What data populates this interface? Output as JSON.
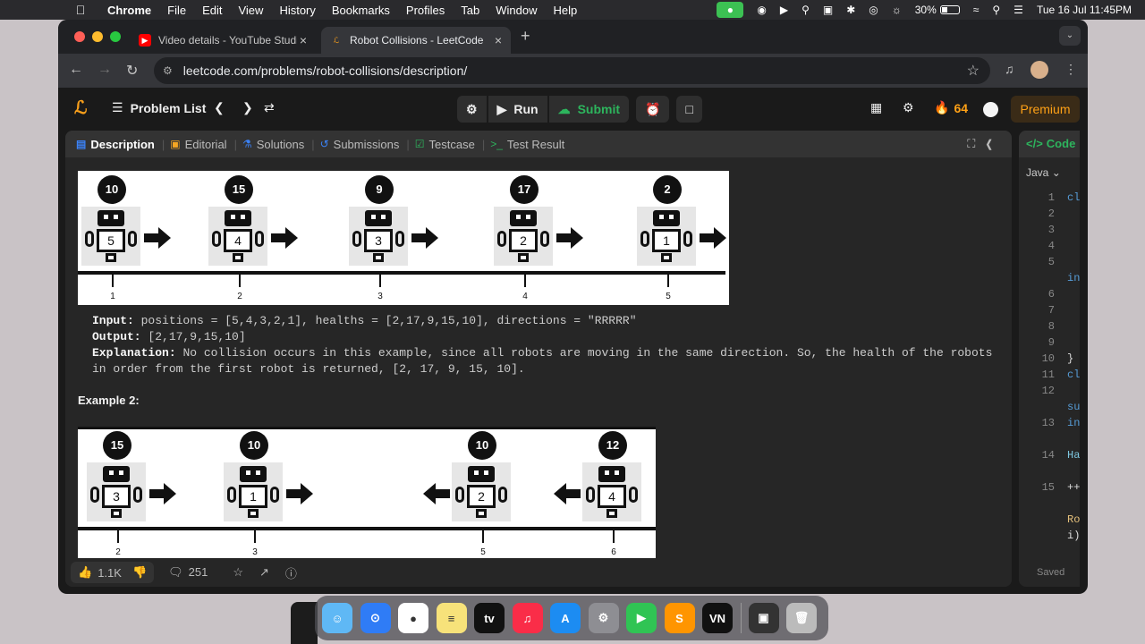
{
  "menubar": {
    "app": "Chrome",
    "items": [
      "File",
      "Edit",
      "View",
      "History",
      "Bookmarks",
      "Profiles",
      "Tab",
      "Window",
      "Help"
    ],
    "battery": "30%",
    "datetime": "Tue 16 Jul  11:45PM"
  },
  "tabs": [
    {
      "title": "Video details - YouTube Studio",
      "active": false
    },
    {
      "title": "Robot Collisions - LeetCode",
      "active": true
    }
  ],
  "address": "leetcode.com/problems/robot-collisions/description/",
  "lc": {
    "problem_list": "Problem List",
    "run": "Run",
    "submit": "Submit",
    "streak": "64",
    "premium": "Premium"
  },
  "panel_tabs": [
    "Description",
    "Editorial",
    "Solutions",
    "Submissions",
    "Testcase",
    "Test Result"
  ],
  "example1": {
    "robots": [
      {
        "health": "10",
        "label": "5",
        "pos": "1"
      },
      {
        "health": "15",
        "label": "4",
        "pos": "2"
      },
      {
        "health": "9",
        "label": "3",
        "pos": "3"
      },
      {
        "health": "17",
        "label": "2",
        "pos": "4"
      },
      {
        "health": "2",
        "label": "1",
        "pos": "5"
      }
    ],
    "input_label": "Input:",
    "input": "positions = [5,4,3,2,1], healths = [2,17,9,15,10], directions = \"RRRRR\"",
    "output_label": "Output:",
    "output": "[2,17,9,15,10]",
    "explanation_label": "Explanation:",
    "explanation": "No collision occurs in this example, since all robots are moving in the same direction. So, the health of the robots in order from the first robot is returned, [2, 17, 9, 15, 10]."
  },
  "example2": {
    "title": "Example 2:",
    "robots": [
      {
        "health": "15",
        "label": "3",
        "pos": "2",
        "dir": "R"
      },
      {
        "health": "10",
        "label": "1",
        "pos": "3",
        "dir": "R"
      },
      {
        "health": "10",
        "label": "2",
        "pos": "5",
        "dir": "L"
      },
      {
        "health": "12",
        "label": "4",
        "pos": "6",
        "dir": "L"
      }
    ]
  },
  "footer": {
    "likes": "1.1K",
    "comments": "251"
  },
  "code": {
    "header": "Code",
    "lang": "Java",
    "lines": [
      "1",
      "2",
      "3",
      "4",
      "5",
      "",
      "6",
      "7",
      "8",
      "9",
      "10",
      "11",
      "12",
      "",
      "13",
      "",
      "14",
      "",
      "15"
    ],
    "tokens": [
      {
        "row": 0,
        "text": "cl"
      },
      {
        "row": 5,
        "text": "in"
      },
      {
        "row": 10,
        "text": "}"
      },
      {
        "row": 11,
        "text": "cl"
      },
      {
        "row": 13,
        "text": "su"
      },
      {
        "row": 14,
        "text": "in"
      },
      {
        "row": 16,
        "text": "Ha"
      },
      {
        "row": 18,
        "text": "++"
      },
      {
        "row": 20,
        "text": "Ro"
      },
      {
        "row": 21,
        "text": "i)"
      }
    ],
    "status": "Saved"
  },
  "dock": [
    "Finder",
    "Safari",
    "Chrome",
    "Notes",
    "TV",
    "Music",
    "App Store",
    "Settings",
    "FaceTime",
    "Sublime",
    "VN",
    "VN Editor",
    "Trash"
  ]
}
